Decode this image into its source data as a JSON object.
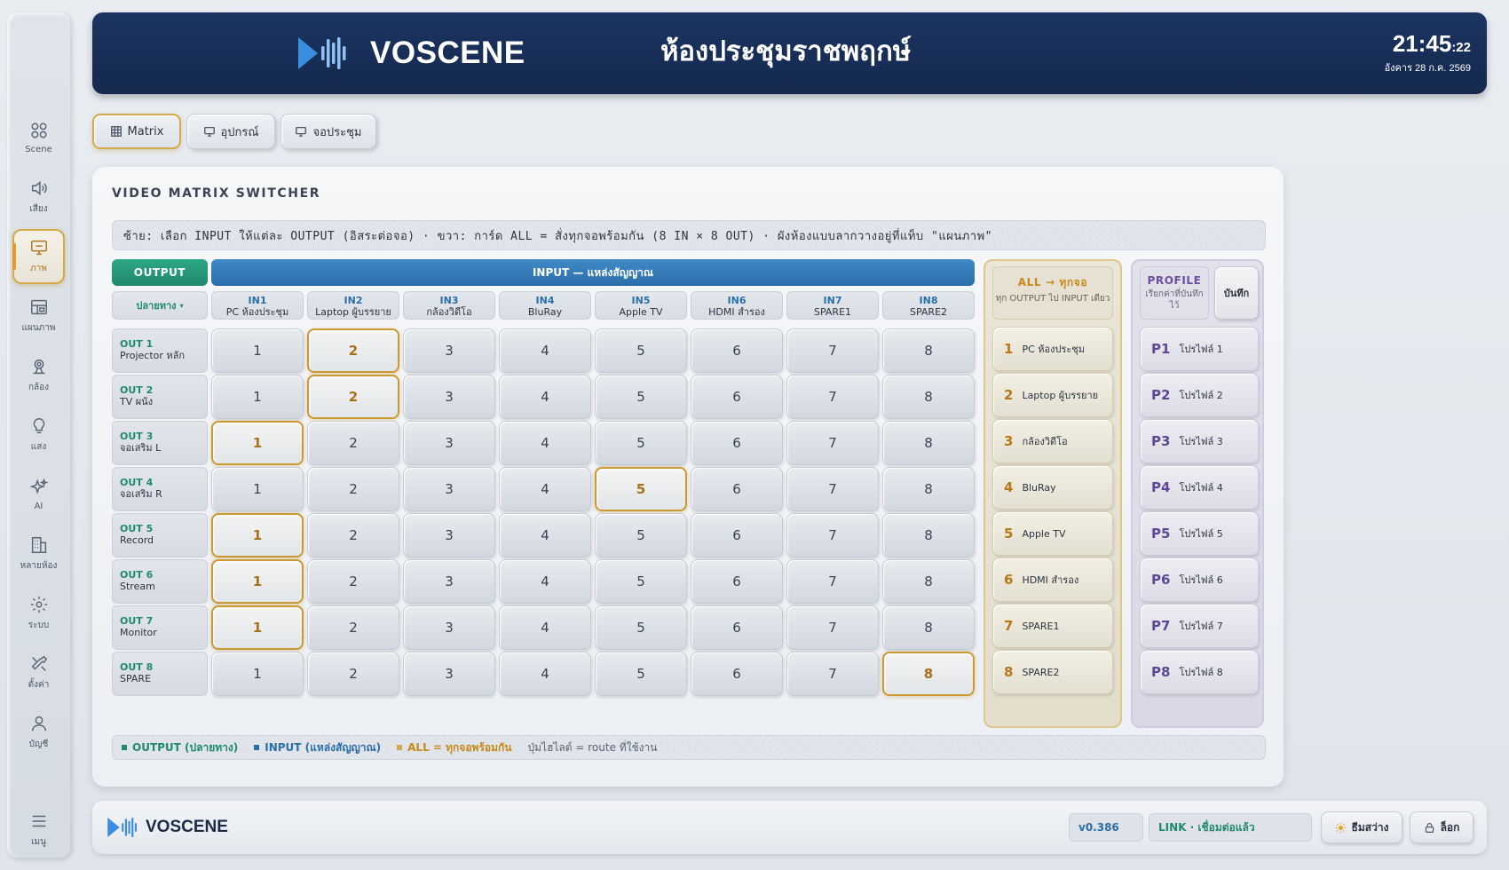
{
  "app": {
    "brand": "VOSCENE",
    "room_title": "ห้องประชุมราชพฤกษ์",
    "clock": {
      "time": "21:45",
      "seconds": ":22",
      "date": "อังคาร 28 ก.ค. 2569"
    }
  },
  "sidebar": {
    "items": [
      {
        "label": "Scene",
        "icon": "grid-icon"
      },
      {
        "label": "เสียง",
        "icon": "speaker-icon"
      },
      {
        "label": "ภาพ",
        "icon": "monitor-icon",
        "active": true
      },
      {
        "label": "แผนภาพ",
        "icon": "layout-icon"
      },
      {
        "label": "กล้อง",
        "icon": "camera-icon"
      },
      {
        "label": "แสง",
        "icon": "bulb-icon"
      },
      {
        "label": "AI",
        "icon": "sparkle-icon"
      },
      {
        "label": "หลายห้อง",
        "icon": "building-icon"
      },
      {
        "label": "ระบบ",
        "icon": "gear-icon"
      },
      {
        "label": "ตั้งค่า",
        "icon": "tools-icon"
      },
      {
        "label": "บัญชี",
        "icon": "user-icon"
      }
    ],
    "menu_label": "เมนู"
  },
  "tabs": [
    {
      "label": "Matrix",
      "icon": "table-icon",
      "active": true
    },
    {
      "label": "อุปกรณ์",
      "icon": "monitor-icon"
    },
    {
      "label": "จอประชุม",
      "icon": "monitor-icon"
    }
  ],
  "matrix": {
    "title": "VIDEO MATRIX SWITCHER",
    "hint": "ซ้าย: เลือก INPUT ให้แต่ละ OUTPUT (อิสระต่อจอ) · ขวา: การ์ด ALL = สั่งทุกจอพร้อมกัน (8 IN × 8 OUT) · ผังห้องแบบลากวางอยู่ที่แท็บ \"แผนภาพ\"",
    "output_header": "OUTPUT",
    "input_header": "INPUT — แหล่งสัญญาณ",
    "dest_label": "ปลายทาง",
    "inputs": [
      {
        "code": "IN1",
        "name": "PC ห้องประชุม"
      },
      {
        "code": "IN2",
        "name": "Laptop ผู้บรรยาย"
      },
      {
        "code": "IN3",
        "name": "กล้องวิดีโอ"
      },
      {
        "code": "IN4",
        "name": "BluRay"
      },
      {
        "code": "IN5",
        "name": "Apple TV"
      },
      {
        "code": "IN6",
        "name": "HDMI สำรอง"
      },
      {
        "code": "IN7",
        "name": "SPARE1"
      },
      {
        "code": "IN8",
        "name": "SPARE2"
      }
    ],
    "outputs": [
      {
        "code": "OUT 1",
        "name": "Projector หลัก",
        "selected": 2
      },
      {
        "code": "OUT 2",
        "name": "TV ผนัง",
        "selected": 2
      },
      {
        "code": "OUT 3",
        "name": "จอเสริม L",
        "selected": 1
      },
      {
        "code": "OUT 4",
        "name": "จอเสริม R",
        "selected": 5
      },
      {
        "code": "OUT 5",
        "name": "Record",
        "selected": 1
      },
      {
        "code": "OUT 6",
        "name": "Stream",
        "selected": 1
      },
      {
        "code": "OUT 7",
        "name": "Monitor",
        "selected": 1
      },
      {
        "code": "OUT 8",
        "name": "SPARE",
        "selected": 8
      }
    ],
    "cell_labels": [
      "1",
      "2",
      "3",
      "4",
      "5",
      "6",
      "7",
      "8"
    ]
  },
  "all_panel": {
    "title": "ALL → ทุกจอ",
    "subtitle": "ทุก OUTPUT ไป INPUT เดียว",
    "items": [
      {
        "num": "1",
        "label": "PC ห้องประชุม"
      },
      {
        "num": "2",
        "label": "Laptop ผู้บรรยาย"
      },
      {
        "num": "3",
        "label": "กล้องวิดีโอ"
      },
      {
        "num": "4",
        "label": "BluRay"
      },
      {
        "num": "5",
        "label": "Apple TV"
      },
      {
        "num": "6",
        "label": "HDMI สำรอง"
      },
      {
        "num": "7",
        "label": "SPARE1"
      },
      {
        "num": "8",
        "label": "SPARE2"
      }
    ]
  },
  "profile_panel": {
    "title": "PROFILE",
    "subtitle": "เรียกค่าที่บันทึกไว้",
    "save_label": "บันทึก",
    "items": [
      {
        "num": "P1",
        "label": "โปรไฟล์ 1"
      },
      {
        "num": "P2",
        "label": "โปรไฟล์ 2"
      },
      {
        "num": "P3",
        "label": "โปรไฟล์ 3"
      },
      {
        "num": "P4",
        "label": "โปรไฟล์ 4"
      },
      {
        "num": "P5",
        "label": "โปรไฟล์ 5"
      },
      {
        "num": "P6",
        "label": "โปรไฟล์ 6"
      },
      {
        "num": "P7",
        "label": "โปรไฟล์ 7"
      },
      {
        "num": "P8",
        "label": "โปรไฟล์ 8"
      }
    ]
  },
  "legend": {
    "output": "OUTPUT (ปลายทาง)",
    "input": "INPUT (แหล่งสัญญาณ)",
    "all": "ALL = ทุกจอพร้อมกัน",
    "note": "ปุ่มไฮไลต์ = route ที่ใช้งาน"
  },
  "footer": {
    "brand": "VOSCENE",
    "version": "v0.386",
    "link_status": "LINK · เชื่อมต่อแล้ว",
    "theme_label": "ธีมสว่าง",
    "lock_label": "ล็อก"
  },
  "colors": {
    "header_bg": "#1b3461",
    "accent_gold": "#d4a94a",
    "output_green": "#1f8a6c",
    "input_blue": "#2a6eaa",
    "profile_purple": "#5e4896"
  }
}
